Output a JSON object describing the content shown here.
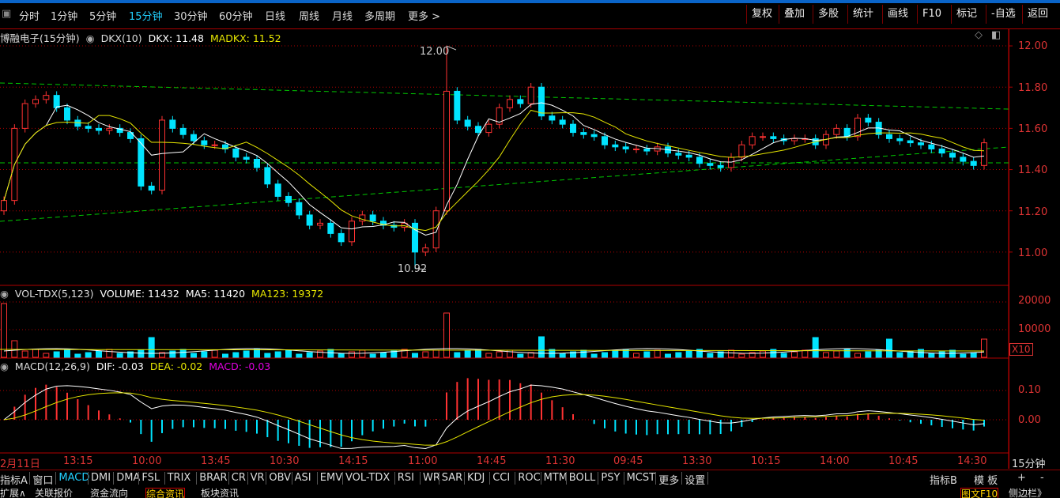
{
  "toolbar": {
    "timeframes": [
      "分时",
      "1分钟",
      "5分钟",
      "15分钟",
      "30分钟",
      "60分钟",
      "日线",
      "周线",
      "月线",
      "多周期",
      "更多 >"
    ],
    "active_timeframe": "15分钟",
    "right_buttons": [
      "复权",
      "叠加",
      "多股",
      "统计",
      "画线",
      "F10",
      "标记",
      "-自选",
      "返回"
    ]
  },
  "main_panel": {
    "stock_name": "博融电子(15分钟)",
    "indicator": "DKX(10)",
    "dkx_label": "DKX: 11.48",
    "madkx_label": "MADKX: 11.52",
    "high_marker": "12.00",
    "low_marker": "10.92",
    "y_ticks": [
      "12.00",
      "11.80",
      "11.60",
      "11.40",
      "11.20",
      "11.00"
    ]
  },
  "volume_panel": {
    "indicator": "VOL-TDX(5,123)",
    "volume_label": "VOLUME: 11432",
    "ma5_label": "MA5: 11420",
    "ma123_label": "MA123: 19372",
    "y_ticks": [
      "20000",
      "10000"
    ],
    "unit": "X10"
  },
  "macd_panel": {
    "indicator": "MACD(12,26,9)",
    "dif_label": "DIF: -0.03",
    "dea_label": "DEA: -0.02",
    "macd_label": "MACD: -0.03",
    "y_ticks": [
      "0.10",
      "0.00"
    ]
  },
  "x_axis": {
    "labels": [
      "2月11日",
      "13:15",
      "10:00",
      "13:45",
      "10:30",
      "14:15",
      "11:00",
      "14:45",
      "11:30",
      "09:45",
      "13:30",
      "10:15",
      "14:00",
      "10:45",
      "14:30"
    ],
    "period": "15分钟"
  },
  "indicator_tabs": [
    "指标A",
    "窗口",
    "MACD",
    "DMI",
    "DMA",
    "FSL",
    "TRIX",
    "BRAR",
    "CR",
    "VR",
    "OBV",
    "ASI",
    "EMV",
    "VOL-TDX",
    "RSI",
    "WR",
    "SAR",
    "KDJ",
    "CCI",
    "ROC",
    "MTM",
    "BOLL",
    "PSY",
    "MCST",
    "更多",
    "设置"
  ],
  "active_indicator_tab": "MACD",
  "right_tabs": [
    "指标B",
    "模 板",
    "+",
    "-"
  ],
  "info_tabs": [
    "扩展∧",
    "关联报价",
    "资金流向",
    "综合资讯",
    "板块资讯"
  ],
  "active_info_tab": "综合资讯",
  "info_right": "图文F10",
  "info_right2": "侧边栏》",
  "colors": {
    "up": "#ff3232",
    "down": "#00e4ff",
    "dkx": "#ffffff",
    "madkx": "#e6e600",
    "trend": "#00c800",
    "grid": "#b00000"
  },
  "chart_data": {
    "type": "candlestick",
    "price_range": [
      10.85,
      12.05
    ],
    "candles_close_approx": [
      11.25,
      11.6,
      11.72,
      11.74,
      11.76,
      11.7,
      11.64,
      11.61,
      11.6,
      11.59,
      11.6,
      11.58,
      11.55,
      11.32,
      11.3,
      11.64,
      11.6,
      11.57,
      11.54,
      11.52,
      11.52,
      11.5,
      11.46,
      11.45,
      11.41,
      11.33,
      11.27,
      11.24,
      11.18,
      11.13,
      11.14,
      11.09,
      11.05,
      11.15,
      11.18,
      11.15,
      11.13,
      11.12,
      11.14,
      11.0,
      11.02,
      11.2,
      11.78,
      11.64,
      11.61,
      11.58,
      11.62,
      11.7,
      11.74,
      11.72,
      11.8,
      11.66,
      11.64,
      11.62,
      11.58,
      11.57,
      11.56,
      11.52,
      11.51,
      11.5,
      11.5,
      11.49,
      11.51,
      11.48,
      11.47,
      11.46,
      11.43,
      11.42,
      11.41,
      11.46,
      11.52,
      11.56,
      11.56,
      11.55,
      11.54,
      11.55,
      11.55,
      11.52,
      11.57,
      11.6,
      11.56,
      11.65,
      11.63,
      11.57,
      11.55,
      11.54,
      11.53,
      11.52,
      11.5,
      11.48,
      11.46,
      11.44,
      11.42,
      11.53
    ]
  }
}
